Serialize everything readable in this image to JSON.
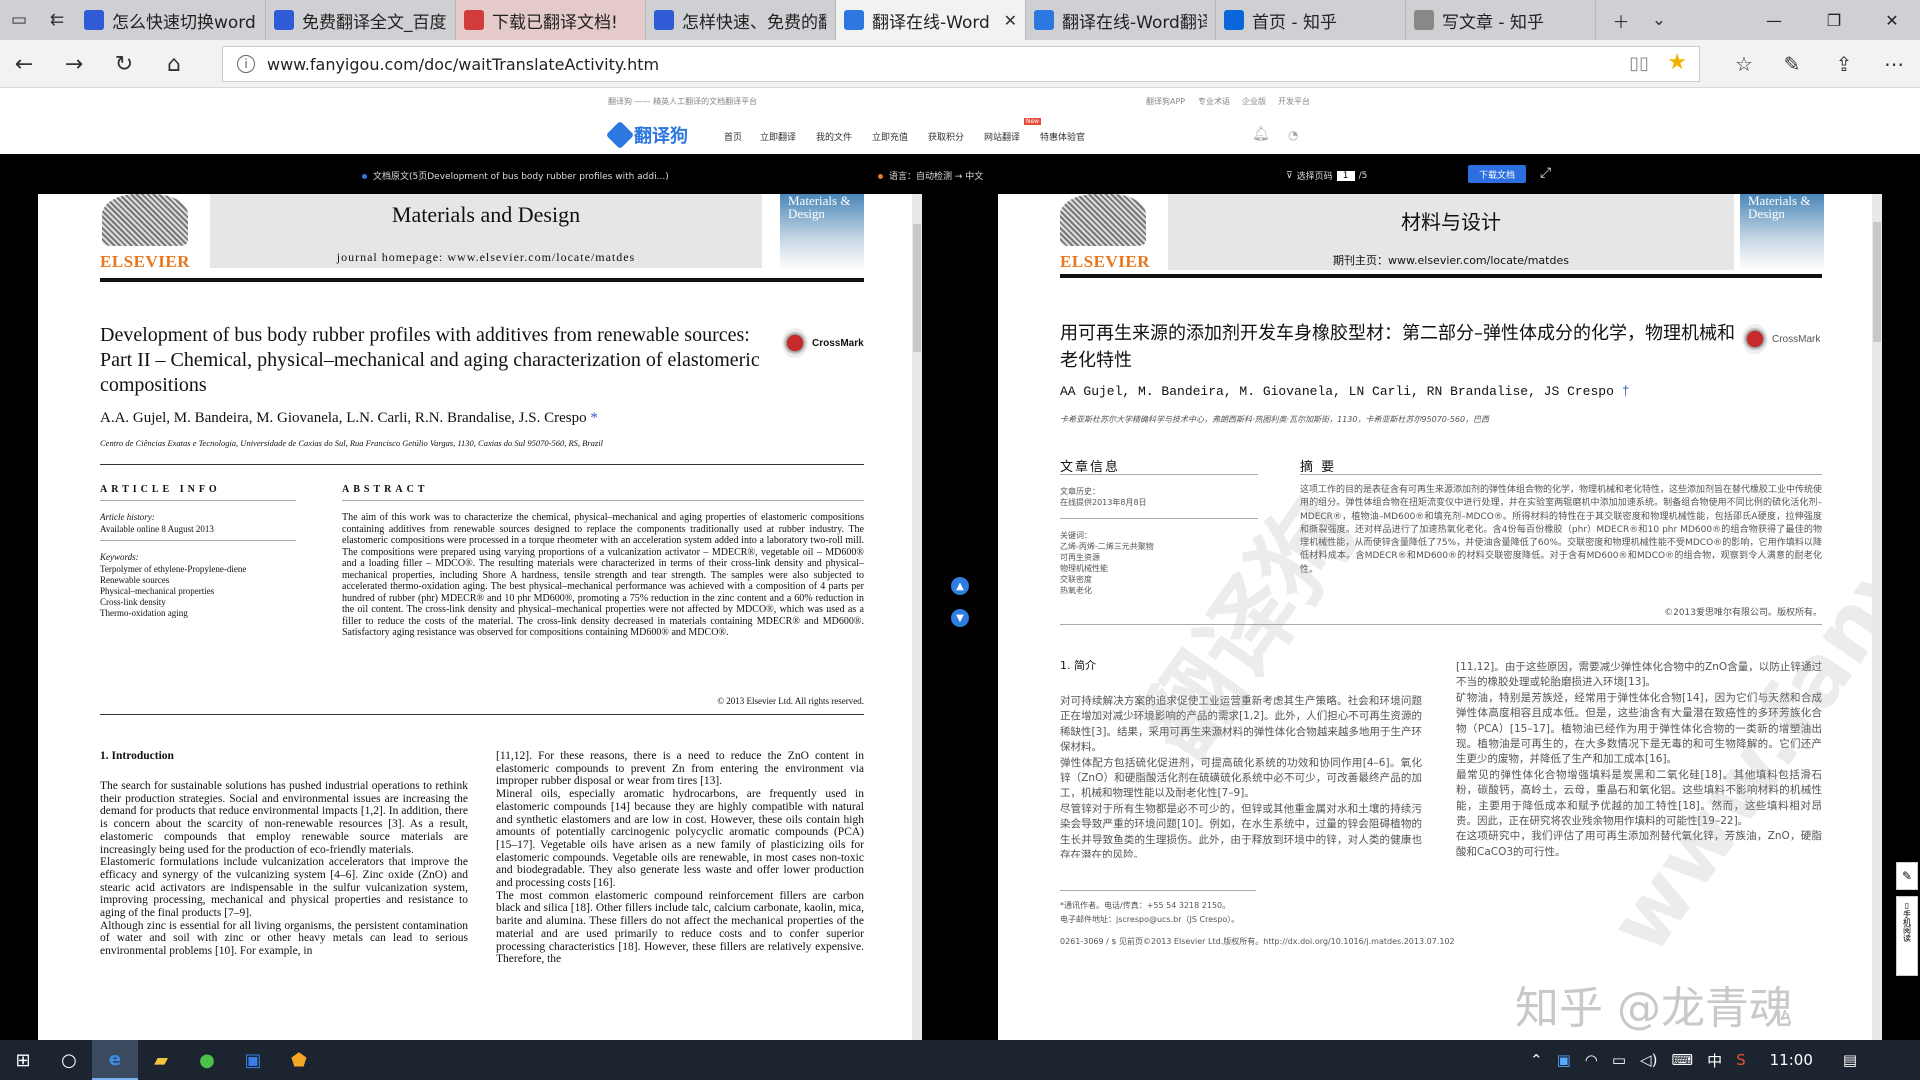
{
  "browser": {
    "tabs": [
      {
        "title": "怎么快速切换word",
        "favicon": "baidu-paw-icon",
        "color": "#2f5bd6"
      },
      {
        "title": "免费翻译全文_百度",
        "favicon": "baidu-paw-icon",
        "color": "#2f5bd6"
      },
      {
        "title": "下载已翻译文档!",
        "favicon": "glasses-icon",
        "color": "#d23b3b"
      },
      {
        "title": "怎样快速、免费的翻",
        "favicon": "baidu-paw-icon",
        "color": "#2f5bd6"
      },
      {
        "title": "翻译在线-Word",
        "favicon": "fanyigou-icon",
        "color": "#2c77e0",
        "active": true
      },
      {
        "title": "翻译在线-Word翻译",
        "favicon": "fanyigou-icon",
        "color": "#2c77e0"
      },
      {
        "title": "首页 - 知乎",
        "favicon": "zhihu-icon",
        "color": "#0a66d8"
      },
      {
        "title": "写文章 - 知乎",
        "favicon": "page-icon",
        "color": "#888"
      }
    ],
    "close_tab": "✕",
    "url": "www.fanyigou.com/doc/waitTranslateActivity.htm"
  },
  "site": {
    "topline_left": "翻译狗 —— 精英人工翻译的文档翻译平台",
    "topline_right": [
      "翻译狗APP",
      "专业术语",
      "企业版",
      "开发平台"
    ],
    "logo_text": "翻译狗",
    "menu": [
      "首页",
      "立即翻译",
      "我的文件",
      "立即充值",
      "获取积分",
      "网站翻译",
      "特惠体验官"
    ],
    "new_badge": "New"
  },
  "doc_toolbar": {
    "file_label": "文档原文(5页Development of bus body rubber profiles with addi...)",
    "language": "语言：自动检测 → 中文",
    "page_select_label": "选择页码",
    "page_current": "1",
    "page_total": "/5",
    "download": "下载文档"
  },
  "original": {
    "journal": "Materials and Design",
    "homepage": "journal homepage: www.elsevier.com/locate/matdes",
    "publisher": "ELSEVIER",
    "cover": "Materials & Design",
    "title": "Development of bus body rubber profiles with additives from renewable sources: Part II – Chemical, physical–mechanical and aging characterization of elastomeric compositions",
    "crossmark": "CrossMark",
    "authors": "A.A. Gujel, M. Bandeira, M. Giovanela, L.N. Carli, R.N. Brandalise, J.S. Crespo",
    "affiliation": "Centro de Ciências Exatas e Tecnologia, Universidade de Caxias do Sul, Rua Francisco Getúlio Vargas, 1130, Caxias do Sul 95070-560, RS, Brazil",
    "article_info_label": "ARTICLE INFO",
    "abstract_label": "ABSTRACT",
    "history_label": "Article history:",
    "history": "Available online 8 August 2013",
    "keywords_label": "Keywords:",
    "keywords": [
      "Terpolymer of ethylene-Propylene-diene",
      "Renewable sources",
      "Physical–mechanical properties",
      "Cross-link density",
      "Thermo-oxidation aging"
    ],
    "abstract": "The aim of this work was to characterize the chemical, physical–mechanical and aging properties of elastomeric compositions containing additives from renewable sources designed to replace the components traditionally used at rubber industry. The elastomeric compositions were processed in a torque rheometer with an acceleration system added into a laboratory two-roll mill. The compositions were prepared using varying proportions of a vulcanization activator – MDECR®, vegetable oil – MD600® and a loading filler – MDCO®. The resulting materials were characterized in terms of their cross-link density and physical–mechanical properties, including Shore A hardness, tensile strength and tear strength. The samples were also subjected to accelerated thermo-oxidation aging. The best physical–mechanical performance was achieved with a composition of 4 parts per hundred of rubber (phr) MDECR® and 10 phr MD600®, promoting a 75% reduction in the zinc content and a 60% reduction in the oil content. The cross-link density and physical–mechanical properties were not affected by MDCO®, which was used as a filler to reduce the costs of the material. The cross-link density decreased in materials containing MDECR® and MD600®. Satisfactory aging resistance was observed for compositions containing MD600® and MDCO®.",
    "copyright": "© 2013 Elsevier Ltd. All rights reserved.",
    "intro_heading": "1. Introduction",
    "col1": "The search for sustainable solutions has pushed industrial operations to rethink their production strategies. Social and environmental issues are increasing the demand for products that reduce environmental impacts [1,2]. In addition, there is concern about the scarcity of non-renewable resources [3]. As a result, elastomeric compounds that employ renewable source materials are increasingly being used for the production of eco-friendly materials.\n    Elastomeric formulations include vulcanization accelerators that improve the efficacy and synergy of the vulcanizing system [4–6]. Zinc oxide (ZnO) and stearic acid activators are indispensable in the sulfur vulcanization system, improving processing, mechanical and physical properties and resistance to aging of the final products [7–9].\n    Although zinc is essential for all living organisms, the persistent contamination of water and soil with zinc or other heavy metals can lead to serious environmental problems [10]. For example, in",
    "col2": "[11,12]. For these reasons, there is a need to reduce the ZnO content in elastomeric compounds to prevent Zn from entering the environment via improper rubber disposal or wear from tires [13].\n    Mineral oils, especially aromatic hydrocarbons, are frequently used in elastomeric compounds [14] because they are highly compatible with natural and synthetic elastomers and are low in cost. However, these oils contain high amounts of potentially carcinogenic polycyclic aromatic compounds (PCA) [15–17]. Vegetable oils have arisen as a new family of plasticizing oils for elastomeric compounds. Vegetable oils are renewable, in most cases non-toxic and biodegradable. They also generate less waste and offer lower production and processing costs [16].\n    The most common elastomeric compound reinforcement fillers are carbon black and silica [18]. Other fillers include talc, calcium carbonate, kaolin, mica, barite and alumina. These fillers do not affect the mechanical properties of the material and are used primarily to reduce costs and to confer superior processing characteristics [18]. However, these fillers are relatively expensive. Therefore, the"
  },
  "translated": {
    "journal": "材料与设计",
    "homepage": "期刊主页：www.elsevier.com/locate/matdes",
    "publisher": "ELSEVIER",
    "cover": "Materials & Design",
    "title": "用可再生来源的添加剂开发车身橡胶型材：第二部分–弹性体成分的化学，物理机械和老化特性",
    "crossmark": "CrossMark",
    "authors": "AA Gujel, M. Bandeira, M. Giovanela, LN Carli, RN Brandalise, JS Crespo",
    "affiliation": "卡希亚斯杜苏尔大学精确科学与技术中心，弗朗西斯科·热图利奥·瓦尔加斯街，1130，卡希亚斯杜苏尔95070-560，巴西",
    "article_info_label": "文章信息",
    "abstract_label": "摘 要",
    "history_label": "文章历史：",
    "history": "在线提供2013年8月8日",
    "keywords_label": "关键词：",
    "keywords": [
      "乙烯-丙烯-二烯三元共聚物",
      "可再生资源",
      "物理机械性能",
      "交联密度",
      "热氧老化"
    ],
    "abstract": "这项工作的目的是表征含有可再生来源添加剂的弹性体组合物的化学，物理机械和老化特性，这些添加剂旨在替代橡胶工业中传统使用的组分。弹性体组合物在扭矩流变仪中进行处理，并在实验室两辊磨机中添加加速系统。制备组合物使用不同比例的硫化活化剂–MDECR®，植物油–MD600®和填充剂–MDCO®。所得材料的特性在于其交联密度和物理机械性能，包括邵氏A硬度，拉伸强度和撕裂强度。还对样品进行了加速热氧化老化。含4份每百份橡胶（phr）MDECR®和10 phr MD600®的组合物获得了最佳的物理机械性能，从而使锌含量降低了75%，并使油含量降低了60%。交联密度和物理机械性能不受MDCO®的影响，它用作填料以降低材料成本。含MDECR®和MD600®的材料交联密度降低。对于含有MD600®和MDCO®的组合物，观察到令人满意的耐老化性。",
    "copyright": "©2013爱思唯尔有限公司。版权所有。",
    "intro_heading": "1. 简介",
    "col1": "对可持续解决方案的追求促使工业运营重新考虑其生产策略。社会和环境问题正在增加对减少环境影响的产品的需求[1,2]。此外，人们担心不可再生资源的稀缺性[3]。结果，采用可再生来源材料的弹性体化合物越来越多地用于生产环保材料。\n    弹性体配方包括硫化促进剂，可提高硫化系统的功效和协同作用[4–6]。氧化锌（ZnO）和硬脂酸活化剂在硫磺硫化系统中必不可少，可改善最终产品的加工，机械和物理性能以及耐老化性[7–9]。\n    尽管锌对于所有生物都是必不可少的，但锌或其他重金属对水和土壤的持续污染会导致严重的环境问题[10]。例如，在水生系统中，过量的锌会阻碍植物的生长并导致鱼类的生理损伤。此外，由于释放到环境中的锌，对人类的健康也存在潜在的风险。",
    "col2": "[11,12]。由于这些原因，需要减少弹性体化合物中的ZnO含量，以防止锌通过不当的橡胶处理或轮胎磨损进入环境[13]。\n    矿物油，特别是芳族烃，经常用于弹性体化合物[14]，因为它们与天然和合成弹性体高度相容且成本低。但是，这些油含有大量潜在致癌性的多环芳族化合物（PCA）[15–17]。植物油已经作为用于弹性体化合物的一类新的增塑油出现。植物油是可再生的，在大多数情况下是无毒的和可生物降解的。它们还产生更少的废物，并降低了生产和加工成本[16]。\n    最常见的弹性体化合物增强填料是炭黑和二氧化硅[18]。其他填料包括滑石粉，碳酸钙，高岭土，云母，重晶石和氧化铝。这些填料不影响材料的机械性能，主要用于降低成本和赋予优越的加工特性[18]。然而，这些填料相对昂贵。因此，正在研究将农业残余物用作填料的可能性[19–22]。\n    在这项研究中，我们评估了用可再生添加剂替代氧化锌，芳族油，ZnO，硬脂酸和CaCO3的可行性。",
    "corresponding": "*通讯作者。电话/传真：+55 54 3218 2150。",
    "email": "电子邮件地址：jscrespo@ucs.br（JS Crespo）。",
    "doi": "0261-3069 / $ 见前页©2013 Elsevier Ltd.版权所有。http://dx.doi.org/10.1016/j.matdes.2013.07.102"
  },
  "watermark": [
    "翻译狗",
    "www.fanyigou.com"
  ],
  "zhihu_watermark": "知乎 @龙青魂",
  "taskbar": {
    "time": "11:00",
    "ime": "中"
  }
}
